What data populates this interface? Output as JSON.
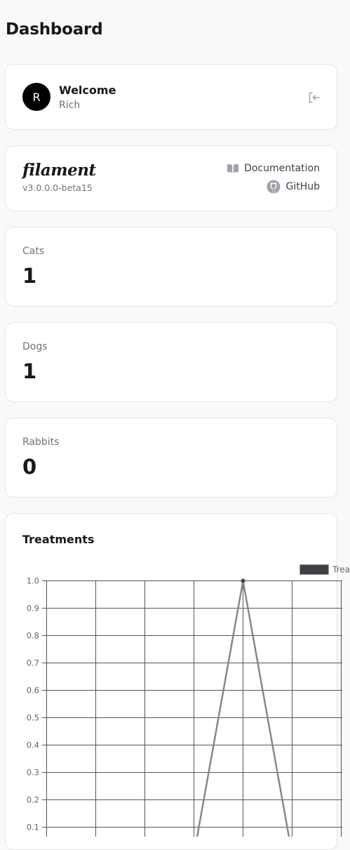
{
  "page": {
    "title": "Dashboard"
  },
  "account": {
    "avatar_initial": "R",
    "heading": "Welcome",
    "user_name": "Rich"
  },
  "filament": {
    "logo_text": "filament",
    "version": "v3.0.0.0-beta15",
    "docs_label": "Documentation",
    "github_label": "GitHub"
  },
  "stats": [
    {
      "label": "Cats",
      "value": "1"
    },
    {
      "label": "Dogs",
      "value": "1"
    },
    {
      "label": "Rabbits",
      "value": "0"
    }
  ],
  "treatments": {
    "heading": "Treatments",
    "legend_label": "Treatments"
  },
  "colors": {
    "line": "#888888",
    "legend_swatch": "#3f3f46",
    "grid": "#555555"
  },
  "chart_data": {
    "type": "line",
    "title": "Treatments",
    "series": [
      {
        "name": "Treatments",
        "values": [
          null,
          null,
          null,
          0,
          1,
          0,
          null
        ]
      }
    ],
    "yticks": [
      0.1,
      0.2,
      0.3,
      0.4,
      0.5,
      0.6,
      0.7,
      0.8,
      0.9,
      1.0
    ],
    "ylim": [
      0,
      1.0
    ],
    "grid": true,
    "legend": "top-right"
  }
}
